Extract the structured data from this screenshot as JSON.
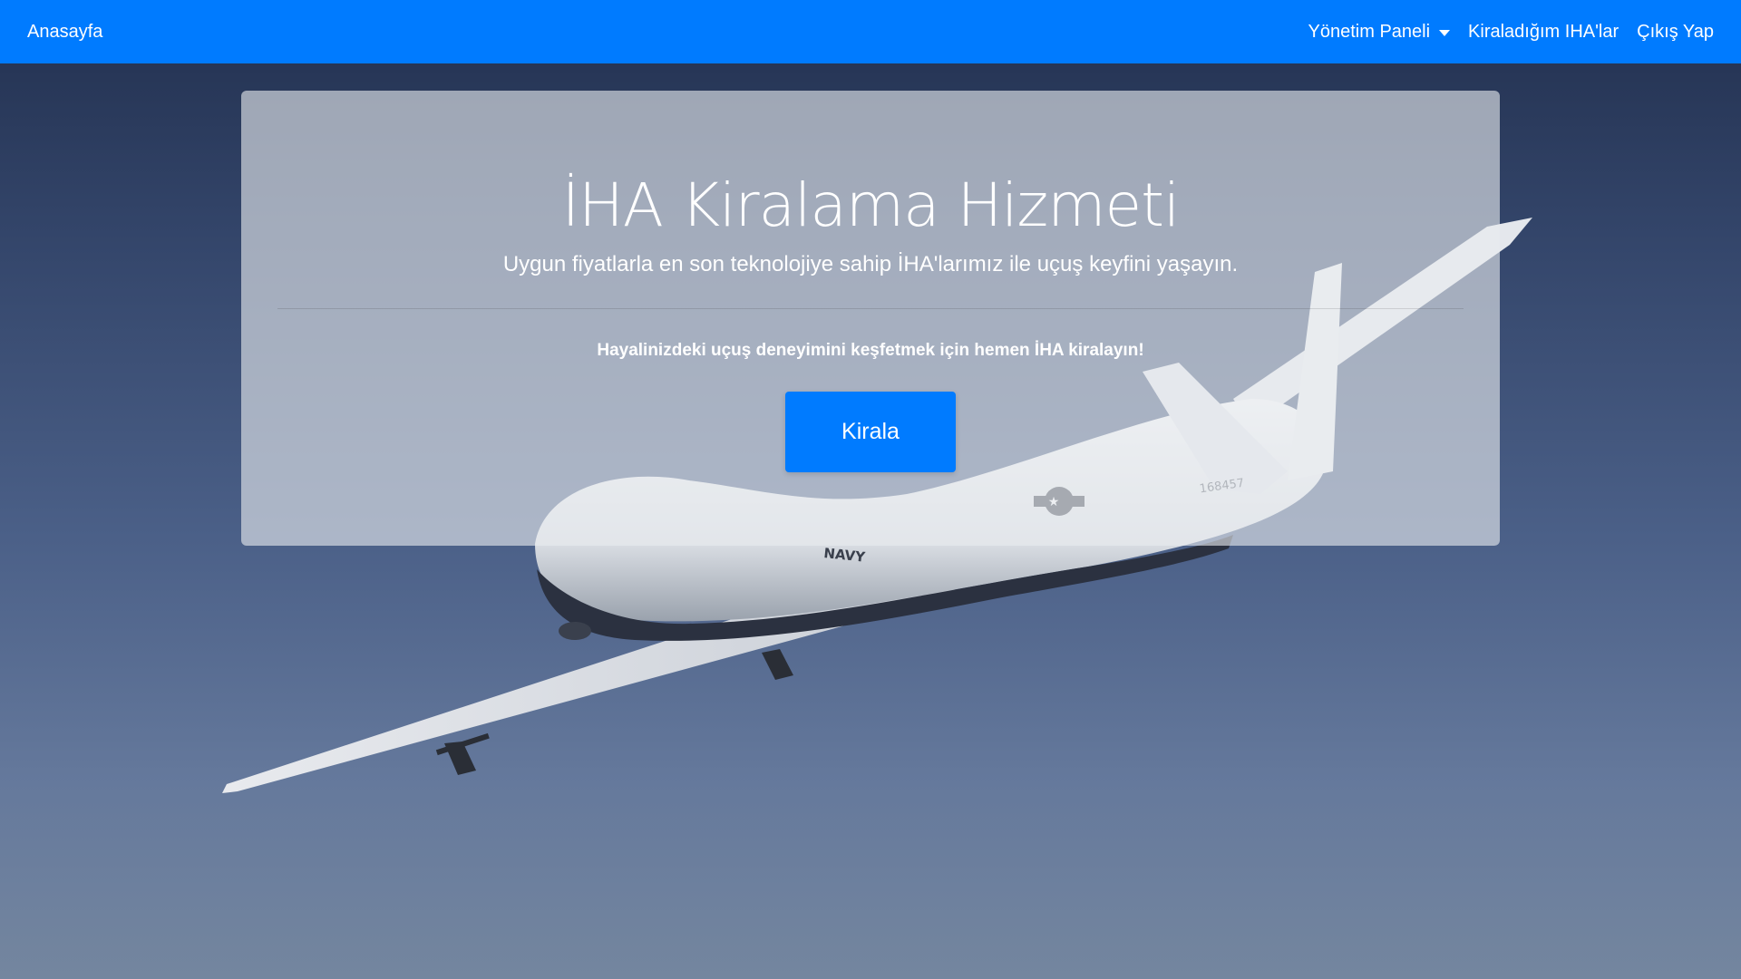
{
  "navbar": {
    "brand": "Anasayfa",
    "items": [
      {
        "label": "Yönetim Paneli",
        "has_dropdown": true
      },
      {
        "label": "Kiraladığım IHA'lar",
        "has_dropdown": false
      },
      {
        "label": "Çıkış Yap",
        "has_dropdown": false
      }
    ]
  },
  "hero": {
    "title": "İHA Kiralama Hizmeti",
    "subtitle": "Uygun fiyatlarla en son teknolojiye sahip İHA'larımız ile uçuş keyfini yaşayın.",
    "cta_text": "Hayalinizdeki uçuş deneyimini keşfetmek için hemen İHA kiralayın!",
    "button_label": "Kirala"
  },
  "background": {
    "fuselage_label": "NAVY",
    "tail_number": "168457"
  },
  "colors": {
    "primary": "#007bff",
    "sky_top": "#22304f",
    "sky_bottom": "#74869f"
  }
}
